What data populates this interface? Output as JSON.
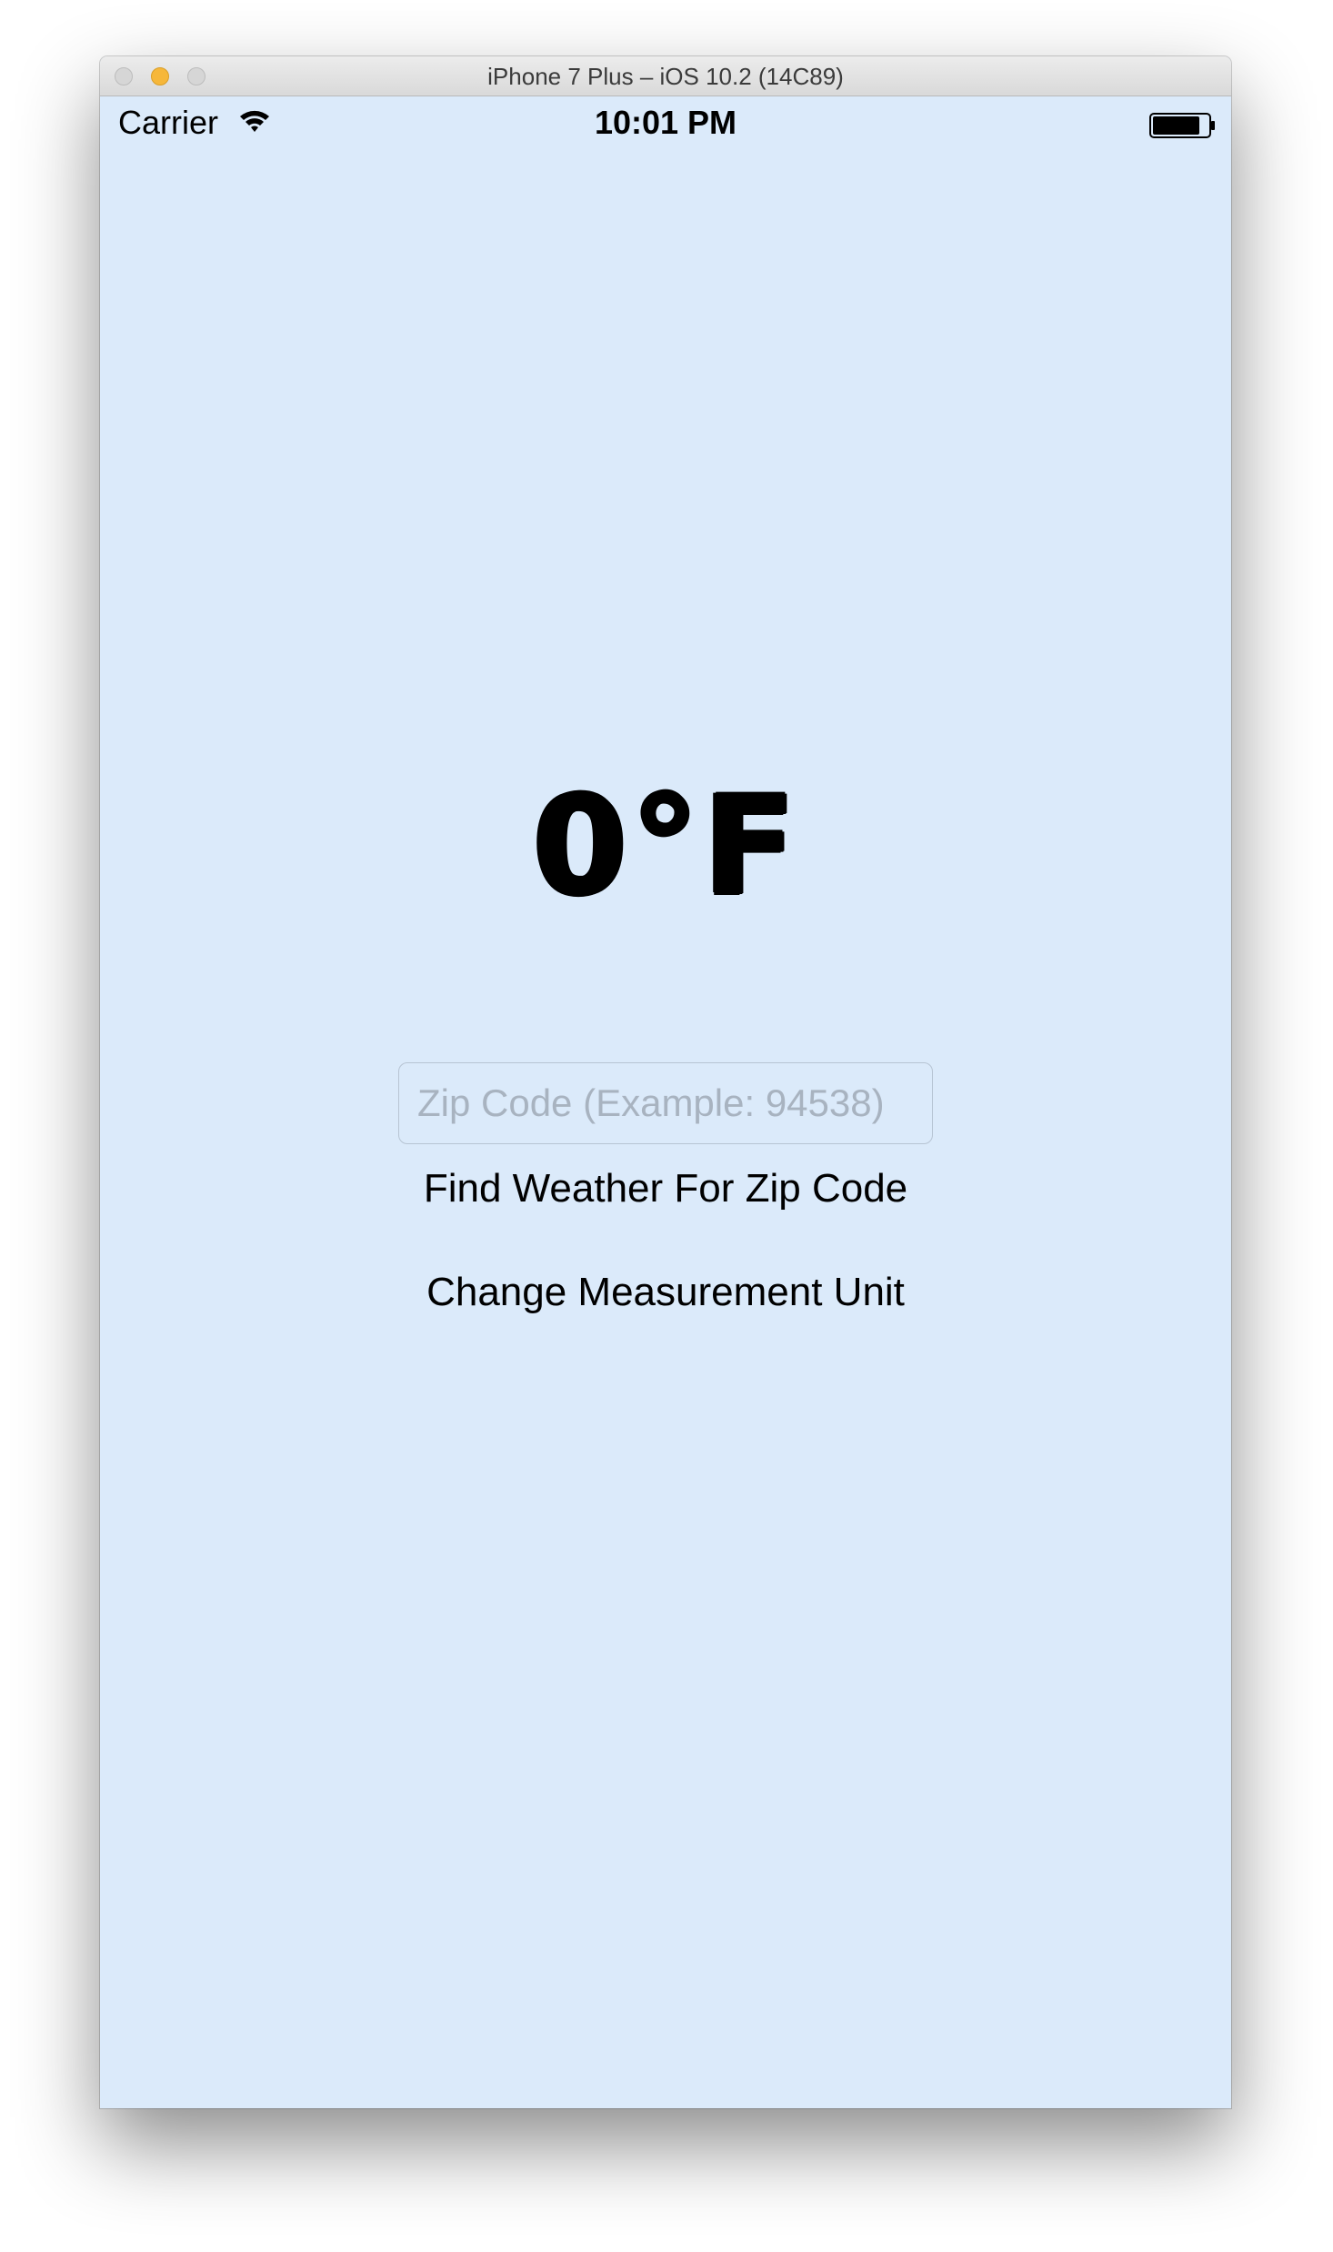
{
  "window": {
    "title": "iPhone 7 Plus – iOS 10.2 (14C89)"
  },
  "status_bar": {
    "carrier": "Carrier",
    "time": "10:01 PM",
    "wifi_icon": "wifi-icon",
    "battery_icon": "battery-icon",
    "battery_level": 0.85
  },
  "main": {
    "temperature": "0°F",
    "zip_input": {
      "placeholder": "Zip Code (Example: 94538)",
      "value": ""
    },
    "find_weather_label": "Find Weather For Zip Code",
    "change_unit_label": "Change Measurement Unit"
  },
  "colors": {
    "screen_background": "#dbeafa",
    "text": "#000000",
    "placeholder": "#a8b3c0",
    "minimize_button": "#f6b73a"
  }
}
